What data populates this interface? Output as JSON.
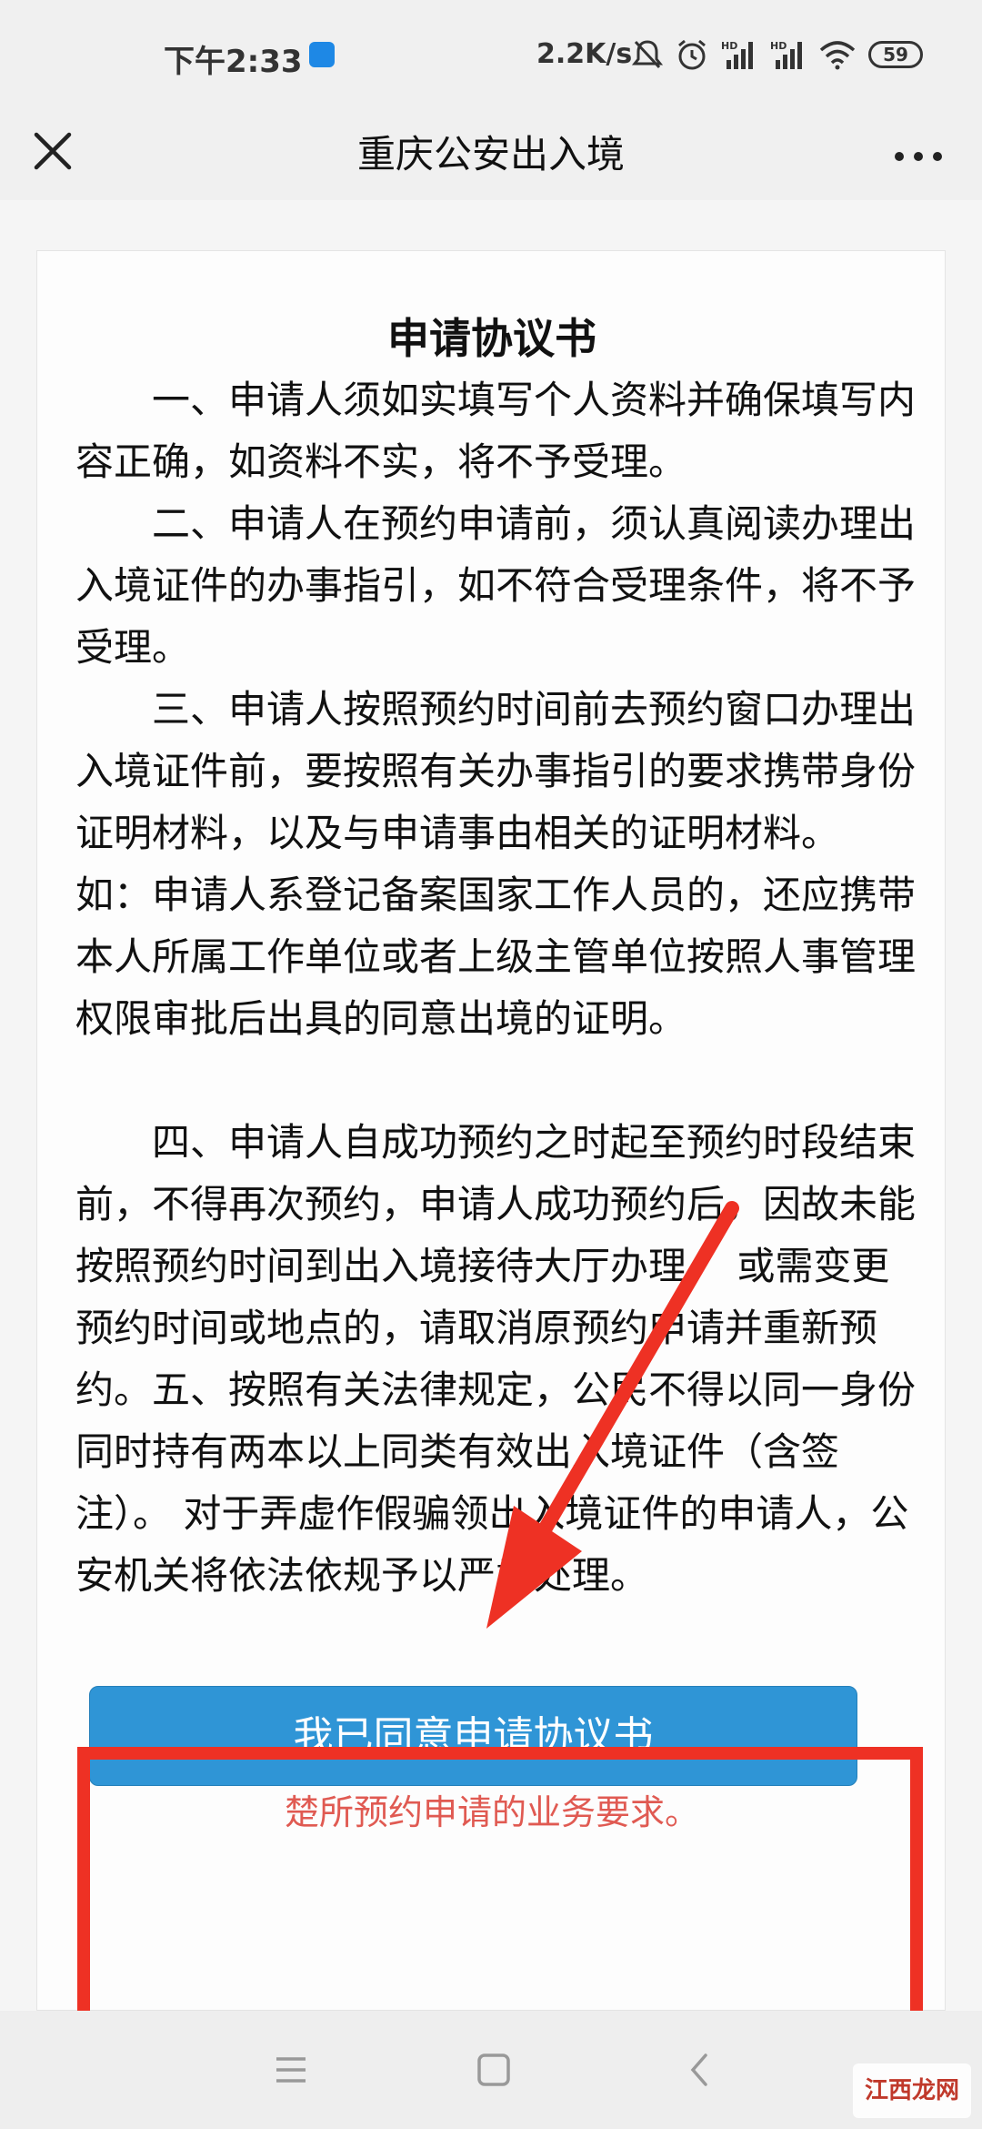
{
  "status_bar": {
    "time": "下午2:33",
    "network_speed": "2.2K/s",
    "battery": "59",
    "icons": [
      "app-notification-icon",
      "mute-icon",
      "alarm-icon",
      "hd-signal-icon",
      "hd-signal-icon",
      "wifi-icon",
      "battery-icon"
    ]
  },
  "header": {
    "title": "重庆公安出入境",
    "close_icon": "close-icon",
    "more_icon": "more-icon"
  },
  "agreement": {
    "title": "申请协议书",
    "paragraphs": [
      "一、申请人须如实填写个人资料并确保填写内容正确，如资料不实，将不予受理。",
      "二、申请人在预约申请前，须认真阅读办理出入境证件的办事指引，如不符合受理条件，将不予受理。",
      "三、申请人按照预约时间前去预约窗口办理出入境证件前，要按照有关办事指引的要求携带身份证明材料，以及与申请事由相关的证明材料。 如：申请人系登记备案国家工作人员的，还应携带本人所属工作单位或者上级主管单位按照人事管理权限审批后出具的同意出境的证明。",
      "四、申请人自成功预约之时起至预约时段结束前，不得再次预约，申请人成功预约后，因故未能按照预约时间到出入境接待大厅办理， 或需变更预约时间或地点的，请取消原预约申请并重新预约。",
      "五、按照有关法律规定，公民不得以同一身份同时持有两本以上同类有效出入境证件（含签注）。 对于弄虚作假骗领出入境证件的申请人，公安机关将依法依规予以严肃处理。"
    ],
    "notice": "我已阅读以上协议及办事须知，并且清楚所预约申请的业务要求。",
    "agree_button": "我已同意申请协议书"
  },
  "annotation": {
    "color": "#ee3124"
  },
  "bottom_nav": {
    "icons": [
      "menu-icon",
      "home-icon",
      "back-icon"
    ]
  },
  "watermark": "江西龙网"
}
